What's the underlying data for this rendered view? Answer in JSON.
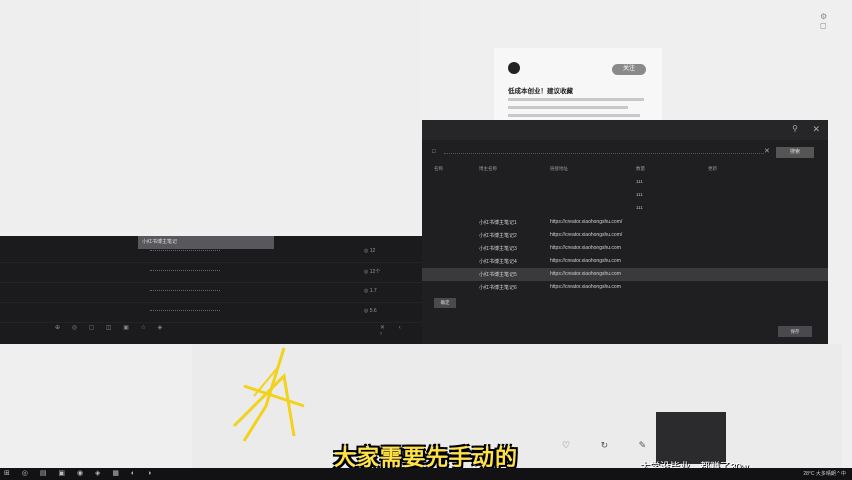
{
  "top_icons": "⚙ ◻",
  "feed": {
    "follow_label": "关注",
    "title": "低成本创业！建议收藏"
  },
  "dialog": {
    "search_label": "□",
    "search_clear": "✕",
    "search_button": "搜索",
    "bottom_left_button": "确定",
    "bottom_right_button": "保存",
    "columns": [
      "名称",
      "博主名称",
      "链接地址",
      "数量",
      "更新"
    ],
    "rows": [
      {
        "name": "",
        "url": "",
        "num": "111"
      },
      {
        "name": "",
        "url": "",
        "num": "111"
      },
      {
        "name": "",
        "url": "",
        "num": "111"
      },
      {
        "name": "小红书博主笔记1",
        "url": "https://creator.xiaohongshu.com/",
        "num": ""
      },
      {
        "name": "小红书博主笔记2",
        "url": "https://creator.xiaohongshu.com/",
        "num": ""
      },
      {
        "name": "小红书博主笔记3",
        "url": "https://creator.xiaohongshu.com",
        "num": ""
      },
      {
        "name": "小红书博主笔记4",
        "url": "https://creator.xiaohongshu.com",
        "num": ""
      },
      {
        "name": "小红书博主笔记5",
        "url": "https://creator.xiaohongshu.com",
        "num": ""
      },
      {
        "name": "小红书博主笔记6",
        "url": "https://creator.xiaohongshu.com",
        "num": ""
      }
    ]
  },
  "left_panel": {
    "header": "小红书博主笔记",
    "row_tags": [
      "◎ 12",
      "◎ 12个",
      "◎ 1.7",
      "◎ 5.6"
    ]
  },
  "subtitle": "大家需要先手动的",
  "right_caption": "大学没毕业，都赚了30w",
  "taskbar": {
    "tray": "28°C 大多晴朗  ^ 中"
  }
}
